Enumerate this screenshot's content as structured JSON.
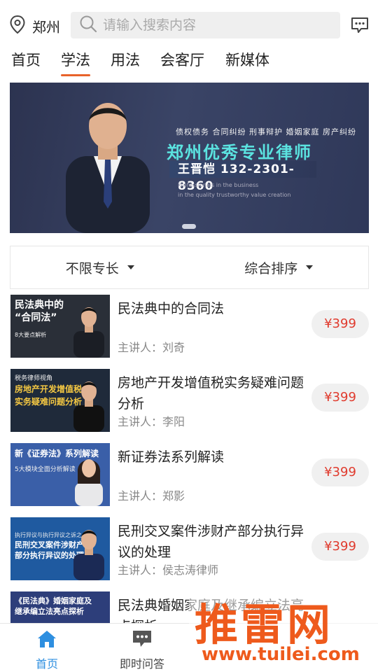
{
  "header": {
    "location": "郑州",
    "search_placeholder": "请输入搜索内容"
  },
  "tabs": [
    {
      "label": "首页",
      "active": false
    },
    {
      "label": "学法",
      "active": true
    },
    {
      "label": "用法",
      "active": false
    },
    {
      "label": "会客厅",
      "active": false
    },
    {
      "label": "新媒体",
      "active": false
    }
  ],
  "banner": {
    "tags": "债权债务  合同纠纷  刑事辩护  婚姻家庭  房产纠纷",
    "headline": "郑州优秀专业律师",
    "contact": "王晋恺 132-2301-8360",
    "sub1": "Professionals in the business",
    "sub2": "in the quality trustworthy value creation"
  },
  "filters": {
    "specialty": "不限专长",
    "sort": "综合排序"
  },
  "courses": [
    {
      "title": "民法典中的合同法",
      "lecturer": "主讲人：刘奇",
      "price": "¥399",
      "thumb_title": "民法典中的\n“合同法”",
      "thumb_sub": "8大要点解析",
      "thumb_color": "#2a2f38"
    },
    {
      "title": "房地产开发增值税实务疑难问题分析",
      "lecturer": "主讲人：李阳",
      "price": "¥399",
      "thumb_title": "房地产开发增值税\n实务疑难问题分析",
      "thumb_sub": "税务律师视角",
      "thumb_color": "#1f2a3a"
    },
    {
      "title": "新证券法系列解读",
      "lecturer": "主讲人：郑影",
      "price": "¥399",
      "thumb_title": "新《证券法》系列解读",
      "thumb_sub": "5大模块全面分析解读",
      "thumb_color": "#3a5fa8"
    },
    {
      "title": "民刑交叉案件涉财产部分执行异议的处理",
      "lecturer": "主讲人：侯志涛律师",
      "price": "¥399",
      "thumb_title": "民刑交叉案件涉财产\n部分执行异议的处理",
      "thumb_sub": "执行异议与执行异议之诉之",
      "thumb_color": "#1f5aa0"
    },
    {
      "title": "民法典婚姻家庭及继承编立法亮点探析",
      "lecturer": "",
      "price": "",
      "thumb_title": "《民法典》婚姻家庭及\n继承编立法亮点探析",
      "thumb_sub": "",
      "thumb_color": "#2d3e7a"
    }
  ],
  "bottom_nav": [
    {
      "label": "首页",
      "icon": "home-icon",
      "active": true
    },
    {
      "label": "即时问答",
      "icon": "chat-icon",
      "active": false
    }
  ],
  "watermark": {
    "text": "推雷网",
    "url": "www.tuilei.com"
  },
  "colors": {
    "accent": "#e8622a",
    "price": "#e03b2e",
    "nav_active": "#2e8fe0"
  }
}
